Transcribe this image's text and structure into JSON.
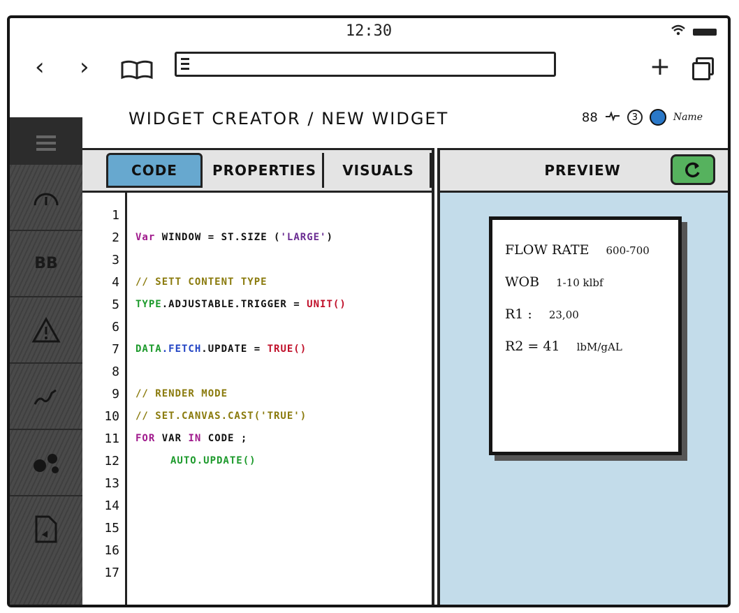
{
  "status": {
    "time": "12:30"
  },
  "browser": {
    "url": ""
  },
  "header": {
    "breadcrumb": "WIDGET CREATOR / NEW WIDGET",
    "count": "88",
    "notifications": "3",
    "user": "Name"
  },
  "sidebar": {
    "items": [
      {
        "icon": "gauge-icon",
        "label": ""
      },
      {
        "icon": "bb-icon",
        "label": "BB"
      },
      {
        "icon": "warning-icon",
        "label": ""
      },
      {
        "icon": "chart-icon",
        "label": ""
      },
      {
        "icon": "gears-icon",
        "label": ""
      },
      {
        "icon": "document-icon",
        "label": ""
      }
    ]
  },
  "tabs": {
    "code": "CODE",
    "properties": "PROPERTIES",
    "visuals": "VISUALS",
    "preview": "PREVIEW"
  },
  "editor": {
    "line_numbers": [
      "1",
      "2",
      "3",
      "4",
      "5",
      "6",
      "7",
      "8",
      "9",
      "10",
      "11",
      "12",
      "13",
      "14",
      "15",
      "16",
      "17"
    ],
    "lines": {
      "l2": {
        "kw": "Var",
        "a": "WINDOW",
        "eq": "=",
        "b": "ST.SIZE (",
        "s": "'LARGE'",
        "c": ")"
      },
      "l4": "// SETT CONTENT TYPE",
      "l5": {
        "a": "TYPE",
        "b": ".ADJUSTABLE.TRIGGER =",
        "c": "UNIT()"
      },
      "l7": {
        "a": "DATA",
        "b": ".FETCH",
        "c": ".UPDATE =",
        "d": "TRUE()"
      },
      "l9": "// RENDER MODE",
      "l10": "// SET.CANVAS.CAST('TRUE')",
      "l11": {
        "kw": "FOR",
        "a": "VAR",
        "in": "IN",
        "b": "CODE ;"
      },
      "l12": "AUTO.UPDATE()"
    }
  },
  "preview": {
    "rows": [
      {
        "label": "FLOW RATE",
        "value": "600-700"
      },
      {
        "label": "WOB",
        "value": "1-10 klbf"
      },
      {
        "label": "R1 :",
        "value": "23,00"
      },
      {
        "label": "R2 = 41",
        "value": "lbM/gAL"
      }
    ]
  },
  "colors": {
    "code_tab": "#67a8cf",
    "run_button": "#56b25e",
    "preview_bg": "#c3dcea",
    "avatar": "#2a78c8"
  }
}
